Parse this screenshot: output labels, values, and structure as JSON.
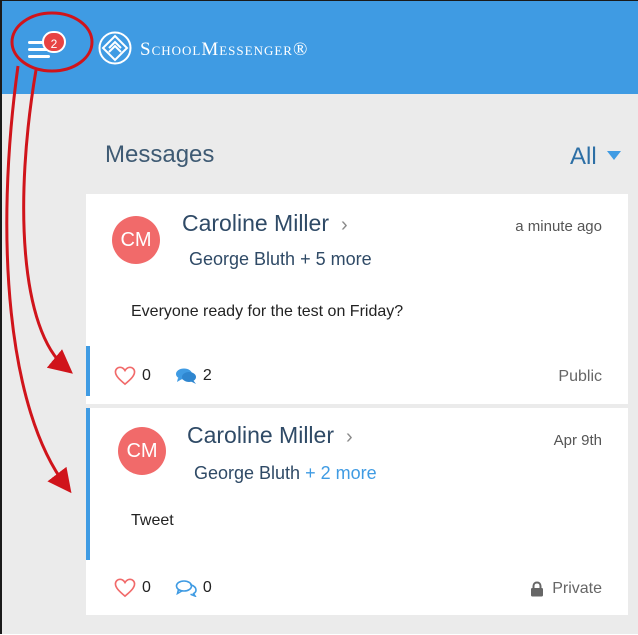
{
  "header": {
    "menu_badge": "2",
    "brand_name": "SchoolMessenger®",
    "accent_color": "#3f9be3"
  },
  "messages": {
    "title": "Messages",
    "filter_label": "All",
    "items": [
      {
        "avatar_initials": "CM",
        "sender": "Caroline Miller",
        "recipients_name": "George Bluth",
        "recipients_more": "+ 5 more",
        "time": "a minute ago",
        "body": "Everyone ready for the test on Friday?",
        "likes": "0",
        "comments": "2",
        "visibility": "Public"
      },
      {
        "avatar_initials": "CM",
        "sender": "Caroline Miller",
        "recipients_name": "George Bluth",
        "recipients_more": "+ 2 more",
        "time": "Apr 9th",
        "body": "Tweet",
        "likes": "0",
        "comments": "0",
        "visibility": "Private"
      }
    ]
  },
  "annotation_color": "#d0141b"
}
